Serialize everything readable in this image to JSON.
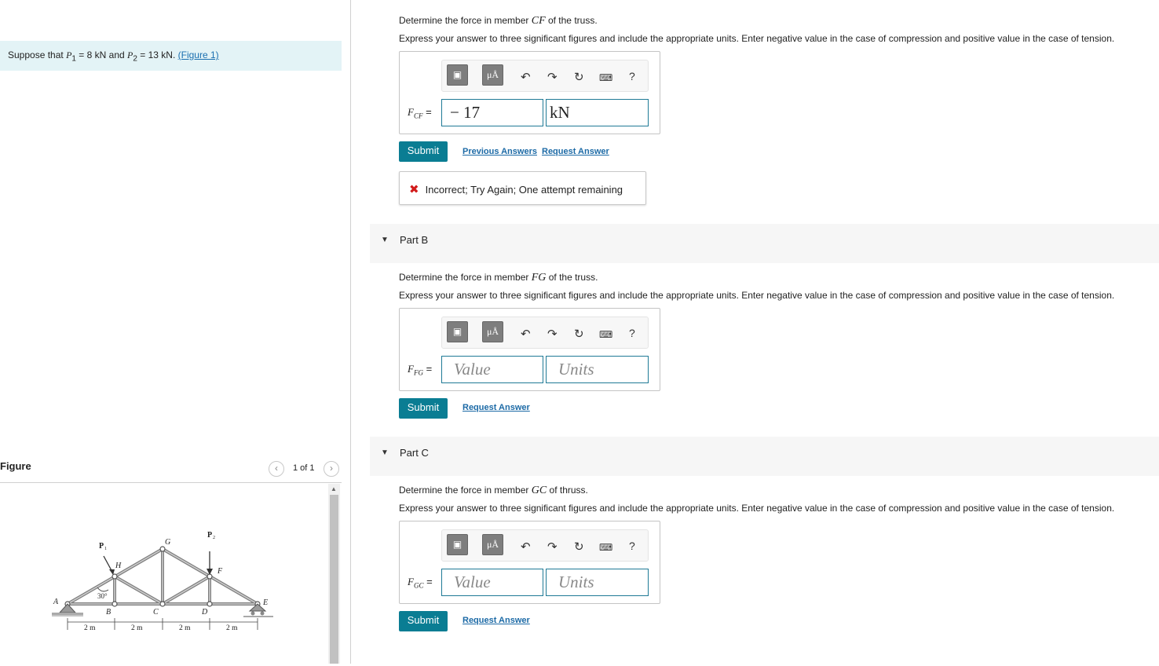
{
  "intro": {
    "text_prefix": "Suppose that ",
    "p1_sym": "P",
    "p1_sub": "1",
    "p1_val": " = 8 kN and ",
    "p2_sym": "P",
    "p2_sub": "2",
    "p2_val": " = 13 kN. ",
    "figure_link": "(Figure 1)"
  },
  "figure": {
    "title": "Figure",
    "pager": "1 of 1",
    "labels": {
      "p1": "P",
      "p1_sub": "1",
      "p2": "P",
      "p2_sub": "2",
      "a": "A",
      "b": "B",
      "c": "C",
      "d": "D",
      "e": "E",
      "f": "F",
      "g": "G",
      "h": "H",
      "angle": "30°",
      "dims": [
        "2 m",
        "2 m",
        "2 m",
        "2 m"
      ]
    }
  },
  "partA": {
    "question_prefix": "Determine the force in member ",
    "member": "CF",
    "question_suffix": " of the truss.",
    "instructions": "Express your answer to three significant figures and include the appropriate units. Enter negative value in the case of compression and positive value in the case of tension.",
    "var": "F",
    "var_sub": "CF",
    "eq": " =",
    "value": "− 17",
    "units": "kN",
    "submit": "Submit",
    "prev_answers": "Previous Answers",
    "request_answer": "Request Answer",
    "feedback": "Incorrect; Try Again; One attempt remaining"
  },
  "partB": {
    "title": "Part B",
    "question_prefix": "Determine the force in member ",
    "member": "FG",
    "question_suffix": " of the truss.",
    "instructions": "Express your answer to three significant figures and include the appropriate units. Enter negative value in the case of compression and positive value in the case of tension.",
    "var": "F",
    "var_sub": "FG",
    "eq": " =",
    "value_placeholder": "Value",
    "units_placeholder": "Units",
    "submit": "Submit",
    "request_answer": "Request Answer"
  },
  "partC": {
    "title": "Part C",
    "question_prefix": "Determine the force in member ",
    "member": "GC",
    "question_suffix": " of thruss.",
    "instructions": "Express your answer to three significant figures and include the appropriate units. Enter negative value in the case of compression and positive value in the case of tension.",
    "var": "F",
    "var_sub": "GC",
    "eq": " =",
    "value_placeholder": "Value",
    "units_placeholder": "Units",
    "submit": "Submit",
    "request_answer": "Request Answer"
  },
  "toolbar": {
    "units_btn": "μÅ",
    "help": "?"
  },
  "icons": {
    "templates": "templates-icon",
    "units": "units-icon",
    "undo": "undo-icon",
    "redo": "redo-icon",
    "reset": "reset-icon",
    "keyboard": "keyboard-icon",
    "help": "help-icon",
    "incorrect": "x-mark-icon",
    "caret": "caret-down-icon"
  },
  "colors": {
    "accent": "#0a7d93",
    "link": "#1c6aa6",
    "error": "#d21b1b",
    "intro_bg": "#e3f3f6"
  }
}
